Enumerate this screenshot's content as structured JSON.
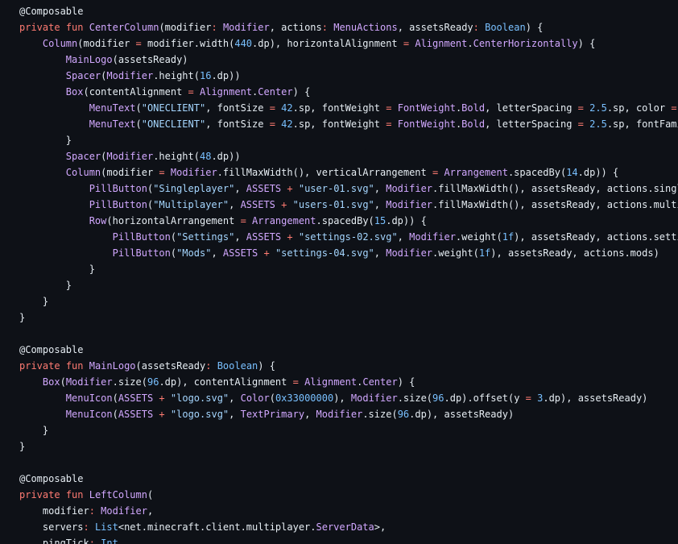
{
  "editor": {
    "theme": {
      "background": "#0e1117",
      "plain": "#e6edf3",
      "keyword": "#ff7b72",
      "function": "#d2a8ff",
      "type": "#d2a8ff",
      "builtin": "#79c0ff",
      "string": "#a5d6ff",
      "number": "#79c0ff",
      "operator": "#ff7b72",
      "annotation": "#e6edf3"
    },
    "lines": [
      [
        [
          "a",
          "@Composable"
        ]
      ],
      [
        [
          "k",
          "private"
        ],
        [
          "p",
          " "
        ],
        [
          "k",
          "fun"
        ],
        [
          "p",
          " "
        ],
        [
          "f",
          "CenterColumn"
        ],
        [
          "p",
          "(modifier"
        ],
        [
          "o",
          ":"
        ],
        [
          "p",
          " "
        ],
        [
          "t",
          "Modifier"
        ],
        [
          "p",
          ", actions"
        ],
        [
          "o",
          ":"
        ],
        [
          "p",
          " "
        ],
        [
          "t",
          "MenuActions"
        ],
        [
          "p",
          ", assetsReady"
        ],
        [
          "o",
          ":"
        ],
        [
          "p",
          " "
        ],
        [
          "b",
          "Boolean"
        ],
        [
          "p",
          ") {"
        ]
      ],
      [
        [
          "p",
          "    "
        ],
        [
          "f",
          "Column"
        ],
        [
          "p",
          "(modifier "
        ],
        [
          "o",
          "="
        ],
        [
          "p",
          " modifier.width("
        ],
        [
          "n",
          "440"
        ],
        [
          "p",
          ".dp), horizontalAlignment "
        ],
        [
          "o",
          "="
        ],
        [
          "p",
          " "
        ],
        [
          "t",
          "Alignment"
        ],
        [
          "p",
          "."
        ],
        [
          "t",
          "CenterHorizontally"
        ],
        [
          "p",
          ") {"
        ]
      ],
      [
        [
          "p",
          "        "
        ],
        [
          "f",
          "MainLogo"
        ],
        [
          "p",
          "(assetsReady)"
        ]
      ],
      [
        [
          "p",
          "        "
        ],
        [
          "f",
          "Spacer"
        ],
        [
          "p",
          "("
        ],
        [
          "t",
          "Modifier"
        ],
        [
          "p",
          ".height("
        ],
        [
          "n",
          "16"
        ],
        [
          "p",
          ".dp))"
        ]
      ],
      [
        [
          "p",
          "        "
        ],
        [
          "f",
          "Box"
        ],
        [
          "p",
          "(contentAlignment "
        ],
        [
          "o",
          "="
        ],
        [
          "p",
          " "
        ],
        [
          "t",
          "Alignment"
        ],
        [
          "p",
          "."
        ],
        [
          "t",
          "Center"
        ],
        [
          "p",
          ") {"
        ]
      ],
      [
        [
          "p",
          "            "
        ],
        [
          "f",
          "MenuText"
        ],
        [
          "p",
          "("
        ],
        [
          "s",
          "\"ONECLIENT\""
        ],
        [
          "p",
          ", fontSize "
        ],
        [
          "o",
          "="
        ],
        [
          "p",
          " "
        ],
        [
          "n",
          "42"
        ],
        [
          "p",
          ".sp, fontWeight "
        ],
        [
          "o",
          "="
        ],
        [
          "p",
          " "
        ],
        [
          "t",
          "FontWeight"
        ],
        [
          "p",
          "."
        ],
        [
          "t",
          "Bold"
        ],
        [
          "p",
          ", letterSpacing "
        ],
        [
          "o",
          "="
        ],
        [
          "p",
          " "
        ],
        [
          "n",
          "2.5"
        ],
        [
          "p",
          ".sp, color "
        ],
        [
          "o",
          "="
        ],
        [
          "p",
          " "
        ]
      ],
      [
        [
          "p",
          "            "
        ],
        [
          "f",
          "MenuText"
        ],
        [
          "p",
          "("
        ],
        [
          "s",
          "\"ONECLIENT\""
        ],
        [
          "p",
          ", fontSize "
        ],
        [
          "o",
          "="
        ],
        [
          "p",
          " "
        ],
        [
          "n",
          "42"
        ],
        [
          "p",
          ".sp, fontWeight "
        ],
        [
          "o",
          "="
        ],
        [
          "p",
          " "
        ],
        [
          "t",
          "FontWeight"
        ],
        [
          "p",
          "."
        ],
        [
          "t",
          "Bold"
        ],
        [
          "p",
          ", letterSpacing "
        ],
        [
          "o",
          "="
        ],
        [
          "p",
          " "
        ],
        [
          "n",
          "2.5"
        ],
        [
          "p",
          ".sp, fontFami"
        ]
      ],
      [
        [
          "p",
          "        }"
        ]
      ],
      [
        [
          "p",
          "        "
        ],
        [
          "f",
          "Spacer"
        ],
        [
          "p",
          "("
        ],
        [
          "t",
          "Modifier"
        ],
        [
          "p",
          ".height("
        ],
        [
          "n",
          "48"
        ],
        [
          "p",
          ".dp))"
        ]
      ],
      [
        [
          "p",
          "        "
        ],
        [
          "f",
          "Column"
        ],
        [
          "p",
          "(modifier "
        ],
        [
          "o",
          "="
        ],
        [
          "p",
          " "
        ],
        [
          "t",
          "Modifier"
        ],
        [
          "p",
          ".fillMaxWidth(), verticalArrangement "
        ],
        [
          "o",
          "="
        ],
        [
          "p",
          " "
        ],
        [
          "t",
          "Arrangement"
        ],
        [
          "p",
          ".spacedBy("
        ],
        [
          "n",
          "14"
        ],
        [
          "p",
          ".dp)) {"
        ]
      ],
      [
        [
          "p",
          "            "
        ],
        [
          "f",
          "PillButton"
        ],
        [
          "p",
          "("
        ],
        [
          "s",
          "\"Singleplayer\""
        ],
        [
          "p",
          ", "
        ],
        [
          "t",
          "ASSETS"
        ],
        [
          "p",
          " "
        ],
        [
          "o",
          "+"
        ],
        [
          "p",
          " "
        ],
        [
          "s",
          "\"user-01.svg\""
        ],
        [
          "p",
          ", "
        ],
        [
          "t",
          "Modifier"
        ],
        [
          "p",
          ".fillMaxWidth(), assetsReady, actions.singl"
        ]
      ],
      [
        [
          "p",
          "            "
        ],
        [
          "f",
          "PillButton"
        ],
        [
          "p",
          "("
        ],
        [
          "s",
          "\"Multiplayer\""
        ],
        [
          "p",
          ", "
        ],
        [
          "t",
          "ASSETS"
        ],
        [
          "p",
          " "
        ],
        [
          "o",
          "+"
        ],
        [
          "p",
          " "
        ],
        [
          "s",
          "\"users-01.svg\""
        ],
        [
          "p",
          ", "
        ],
        [
          "t",
          "Modifier"
        ],
        [
          "p",
          ".fillMaxWidth(), assetsReady, actions.multi"
        ]
      ],
      [
        [
          "p",
          "            "
        ],
        [
          "f",
          "Row"
        ],
        [
          "p",
          "(horizontalArrangement "
        ],
        [
          "o",
          "="
        ],
        [
          "p",
          " "
        ],
        [
          "t",
          "Arrangement"
        ],
        [
          "p",
          ".spacedBy("
        ],
        [
          "n",
          "15"
        ],
        [
          "p",
          ".dp)) {"
        ]
      ],
      [
        [
          "p",
          "                "
        ],
        [
          "f",
          "PillButton"
        ],
        [
          "p",
          "("
        ],
        [
          "s",
          "\"Settings\""
        ],
        [
          "p",
          ", "
        ],
        [
          "t",
          "ASSETS"
        ],
        [
          "p",
          " "
        ],
        [
          "o",
          "+"
        ],
        [
          "p",
          " "
        ],
        [
          "s",
          "\"settings-02.svg\""
        ],
        [
          "p",
          ", "
        ],
        [
          "t",
          "Modifier"
        ],
        [
          "p",
          ".weight("
        ],
        [
          "n",
          "1f"
        ],
        [
          "p",
          "), assetsReady, actions.setti"
        ]
      ],
      [
        [
          "p",
          "                "
        ],
        [
          "f",
          "PillButton"
        ],
        [
          "p",
          "("
        ],
        [
          "s",
          "\"Mods\""
        ],
        [
          "p",
          ", "
        ],
        [
          "t",
          "ASSETS"
        ],
        [
          "p",
          " "
        ],
        [
          "o",
          "+"
        ],
        [
          "p",
          " "
        ],
        [
          "s",
          "\"settings-04.svg\""
        ],
        [
          "p",
          ", "
        ],
        [
          "t",
          "Modifier"
        ],
        [
          "p",
          ".weight("
        ],
        [
          "n",
          "1f"
        ],
        [
          "p",
          "), assetsReady, actions.mods)"
        ]
      ],
      [
        [
          "p",
          "            }"
        ]
      ],
      [
        [
          "p",
          "        }"
        ]
      ],
      [
        [
          "p",
          "    }"
        ]
      ],
      [
        [
          "p",
          "}"
        ]
      ],
      [],
      [
        [
          "a",
          "@Composable"
        ]
      ],
      [
        [
          "k",
          "private"
        ],
        [
          "p",
          " "
        ],
        [
          "k",
          "fun"
        ],
        [
          "p",
          " "
        ],
        [
          "f",
          "MainLogo"
        ],
        [
          "p",
          "(assetsReady"
        ],
        [
          "o",
          ":"
        ],
        [
          "p",
          " "
        ],
        [
          "b",
          "Boolean"
        ],
        [
          "p",
          ") {"
        ]
      ],
      [
        [
          "p",
          "    "
        ],
        [
          "f",
          "Box"
        ],
        [
          "p",
          "("
        ],
        [
          "t",
          "Modifier"
        ],
        [
          "p",
          ".size("
        ],
        [
          "n",
          "96"
        ],
        [
          "p",
          ".dp), contentAlignment "
        ],
        [
          "o",
          "="
        ],
        [
          "p",
          " "
        ],
        [
          "t",
          "Alignment"
        ],
        [
          "p",
          "."
        ],
        [
          "t",
          "Center"
        ],
        [
          "p",
          ") {"
        ]
      ],
      [
        [
          "p",
          "        "
        ],
        [
          "f",
          "MenuIcon"
        ],
        [
          "p",
          "("
        ],
        [
          "t",
          "ASSETS"
        ],
        [
          "p",
          " "
        ],
        [
          "o",
          "+"
        ],
        [
          "p",
          " "
        ],
        [
          "s",
          "\"logo.svg\""
        ],
        [
          "p",
          ", "
        ],
        [
          "f",
          "Color"
        ],
        [
          "p",
          "("
        ],
        [
          "n",
          "0x33000000"
        ],
        [
          "p",
          "), "
        ],
        [
          "t",
          "Modifier"
        ],
        [
          "p",
          ".size("
        ],
        [
          "n",
          "96"
        ],
        [
          "p",
          ".dp).offset(y "
        ],
        [
          "o",
          "="
        ],
        [
          "p",
          " "
        ],
        [
          "n",
          "3"
        ],
        [
          "p",
          ".dp), assetsReady)"
        ]
      ],
      [
        [
          "p",
          "        "
        ],
        [
          "f",
          "MenuIcon"
        ],
        [
          "p",
          "("
        ],
        [
          "t",
          "ASSETS"
        ],
        [
          "p",
          " "
        ],
        [
          "o",
          "+"
        ],
        [
          "p",
          " "
        ],
        [
          "s",
          "\"logo.svg\""
        ],
        [
          "p",
          ", "
        ],
        [
          "t",
          "TextPrimary"
        ],
        [
          "p",
          ", "
        ],
        [
          "t",
          "Modifier"
        ],
        [
          "p",
          ".size("
        ],
        [
          "n",
          "96"
        ],
        [
          "p",
          ".dp), assetsReady)"
        ]
      ],
      [
        [
          "p",
          "    }"
        ]
      ],
      [
        [
          "p",
          "}"
        ]
      ],
      [],
      [
        [
          "a",
          "@Composable"
        ]
      ],
      [
        [
          "k",
          "private"
        ],
        [
          "p",
          " "
        ],
        [
          "k",
          "fun"
        ],
        [
          "p",
          " "
        ],
        [
          "f",
          "LeftColumn"
        ],
        [
          "p",
          "("
        ]
      ],
      [
        [
          "p",
          "    modifier"
        ],
        [
          "o",
          ":"
        ],
        [
          "p",
          " "
        ],
        [
          "t",
          "Modifier"
        ],
        [
          "p",
          ","
        ]
      ],
      [
        [
          "p",
          "    servers"
        ],
        [
          "o",
          ":"
        ],
        [
          "p",
          " "
        ],
        [
          "b",
          "List"
        ],
        [
          "p",
          "<net.minecraft.client.multiplayer."
        ],
        [
          "t",
          "ServerData"
        ],
        [
          "p",
          ">,"
        ]
      ],
      [
        [
          "p",
          "    pingTick"
        ],
        [
          "o",
          ":"
        ],
        [
          "p",
          " "
        ],
        [
          "b",
          "Int"
        ],
        [
          "p",
          ","
        ]
      ]
    ]
  }
}
